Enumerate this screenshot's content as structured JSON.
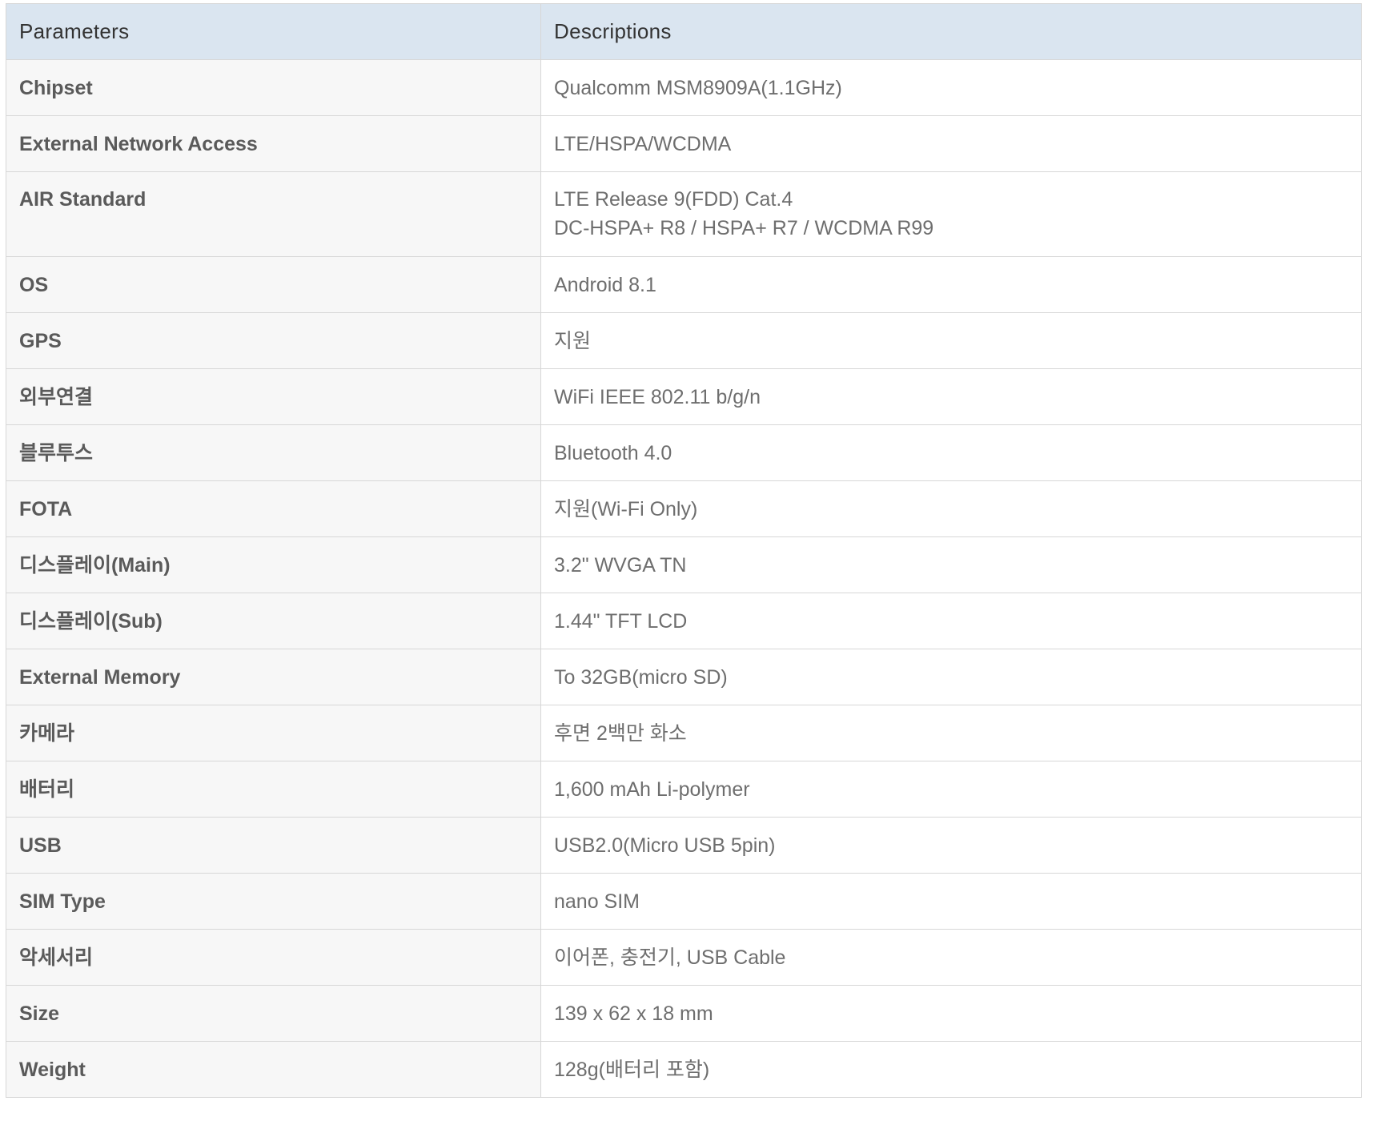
{
  "table": {
    "headers": {
      "param": "Parameters",
      "desc": "Descriptions"
    },
    "rows": [
      {
        "param": "Chipset",
        "desc": [
          "Qualcomm MSM8909A(1.1GHz)"
        ]
      },
      {
        "param": "External Network Access",
        "desc": [
          "LTE/HSPA/WCDMA"
        ]
      },
      {
        "param": "AIR Standard",
        "desc": [
          "LTE Release 9(FDD) Cat.4",
          "DC-HSPA+ R8 / HSPA+ R7 / WCDMA R99"
        ]
      },
      {
        "param": "OS",
        "desc": [
          "Android 8.1"
        ]
      },
      {
        "param": "GPS",
        "desc": [
          "지원"
        ]
      },
      {
        "param": "외부연결",
        "desc": [
          "WiFi IEEE 802.11 b/g/n"
        ]
      },
      {
        "param": "블루투스",
        "desc": [
          "Bluetooth 4.0"
        ]
      },
      {
        "param": "FOTA",
        "desc": [
          "지원(Wi-Fi Only)"
        ]
      },
      {
        "param": "디스플레이(Main)",
        "desc": [
          "3.2\" WVGA TN"
        ]
      },
      {
        "param": "디스플레이(Sub)",
        "desc": [
          "1.44\" TFT LCD"
        ]
      },
      {
        "param": "External Memory",
        "desc": [
          "To 32GB(micro SD)"
        ]
      },
      {
        "param": "카메라",
        "desc": [
          "후면 2백만 화소"
        ]
      },
      {
        "param": "배터리",
        "desc": [
          "1,600 mAh Li-polymer"
        ]
      },
      {
        "param": "USB",
        "desc": [
          "USB2.0(Micro USB 5pin)"
        ]
      },
      {
        "param": "SIM Type",
        "desc": [
          "nano SIM"
        ]
      },
      {
        "param": "악세서리",
        "desc": [
          "이어폰, 충전기, USB Cable"
        ]
      },
      {
        "param": "Size",
        "desc": [
          "139 x 62 x 18 mm"
        ]
      },
      {
        "param": "Weight",
        "desc": [
          "128g(배터리 포함)"
        ]
      }
    ]
  }
}
